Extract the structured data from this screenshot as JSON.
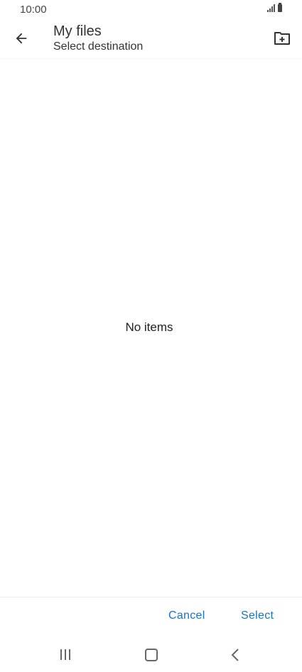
{
  "status_bar": {
    "time": "10:00",
    "icons": [
      "signal-icon",
      "battery-icon"
    ]
  },
  "app_bar": {
    "title": "My files",
    "subtitle": "Select destination",
    "icons": [
      "back-arrow-icon",
      "new-folder-icon"
    ]
  },
  "content": {
    "empty_message": "No items"
  },
  "actions": {
    "cancel_label": "Cancel",
    "select_label": "Select",
    "accent_color": "#1a73c8"
  },
  "nav_bar": {
    "icons": [
      "recent-apps-icon",
      "home-icon",
      "back-icon"
    ]
  }
}
